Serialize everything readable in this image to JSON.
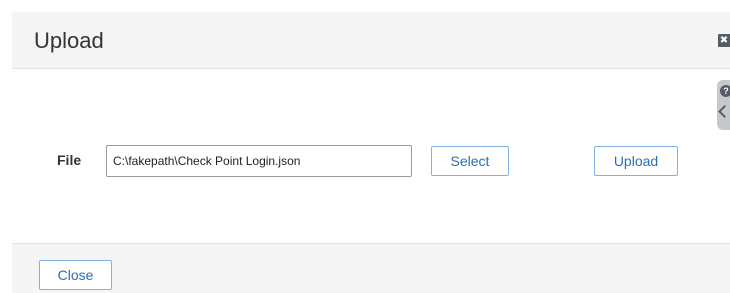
{
  "dialog": {
    "title": "Upload",
    "close_icon_glyph": "✖",
    "help_icon_glyph": "?"
  },
  "form": {
    "file_label": "File",
    "file_value": "C:\\fakepath\\Check Point Login.json",
    "select_label": "Select",
    "upload_label": "Upload"
  },
  "footer": {
    "close_label": "Close"
  },
  "colors": {
    "accent": "#2a6db4",
    "button_border": "#7fb2e6",
    "header_bg": "#f5f5f5"
  }
}
